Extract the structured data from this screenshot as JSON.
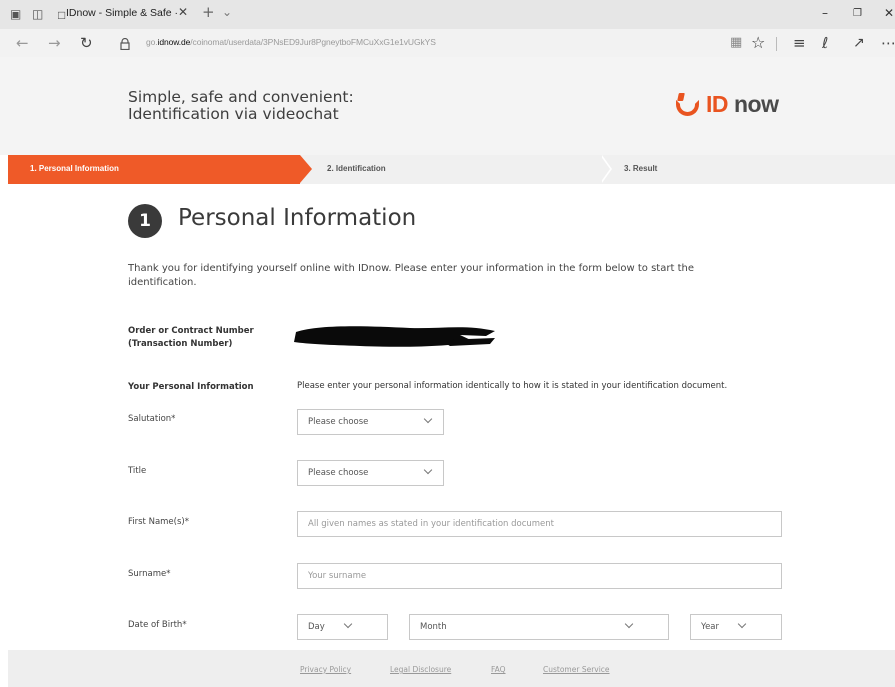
{
  "browser": {
    "tab_title": "IDnow - Simple & Safe ·",
    "url_prefix": "go.",
    "url_domain": "idnow.de",
    "url_path": "/coinomat/userdata/3PNsED9Jur8PgneytboFMCuXxG1e1vUGkYS",
    "icons": [
      "tab-preview-icon",
      "set-aside-tabs-icon",
      "page-icon",
      "close-icon",
      "new-tab-icon",
      "tab-list-icon",
      "minimize-icon",
      "restore-icon",
      "close-window-icon",
      "back-icon",
      "forward-icon",
      "refresh-icon",
      "lock-icon",
      "reading-view-icon",
      "favorite-star-icon",
      "hub-icon",
      "web-note-icon",
      "share-icon",
      "more-icon"
    ]
  },
  "header": {
    "headline_line1": "Simple, safe and convenient:",
    "headline_line2": "Identification via videochat",
    "logo_id": "ID",
    "logo_now": "now",
    "brand_color": "#e95420"
  },
  "steps": [
    {
      "label": "1. Personal Information",
      "active": true
    },
    {
      "label": "2. Identification",
      "active": false
    },
    {
      "label": "3. Result",
      "active": false
    }
  ],
  "form": {
    "step_number": "1",
    "title": "Personal Information",
    "intro": "Thank you for identifying yourself online with IDnow. Please enter your information in the form below to start the identification.",
    "order_label_line1": "Order or Contract Number",
    "order_label_line2": "(Transaction Number)",
    "personal_info_label": "Your Personal Information",
    "personal_info_hint": "Please enter your personal information identically to how it is stated in your identification document.",
    "salutation_label": "Salutation*",
    "salutation_value": "Please choose",
    "title_label": "Title",
    "title_value": "Please choose",
    "first_names_label": "First Name(s)*",
    "first_names_placeholder": "All given names as stated in your identification document",
    "surname_label": "Surname*",
    "surname_placeholder": "Your surname",
    "dob_label": "Date of Birth*",
    "dob_day": "Day",
    "dob_month": "Month",
    "dob_year": "Year"
  },
  "footer": {
    "links": [
      "Privacy Policy",
      "Legal Disclosure",
      "FAQ",
      "Customer Service"
    ]
  }
}
